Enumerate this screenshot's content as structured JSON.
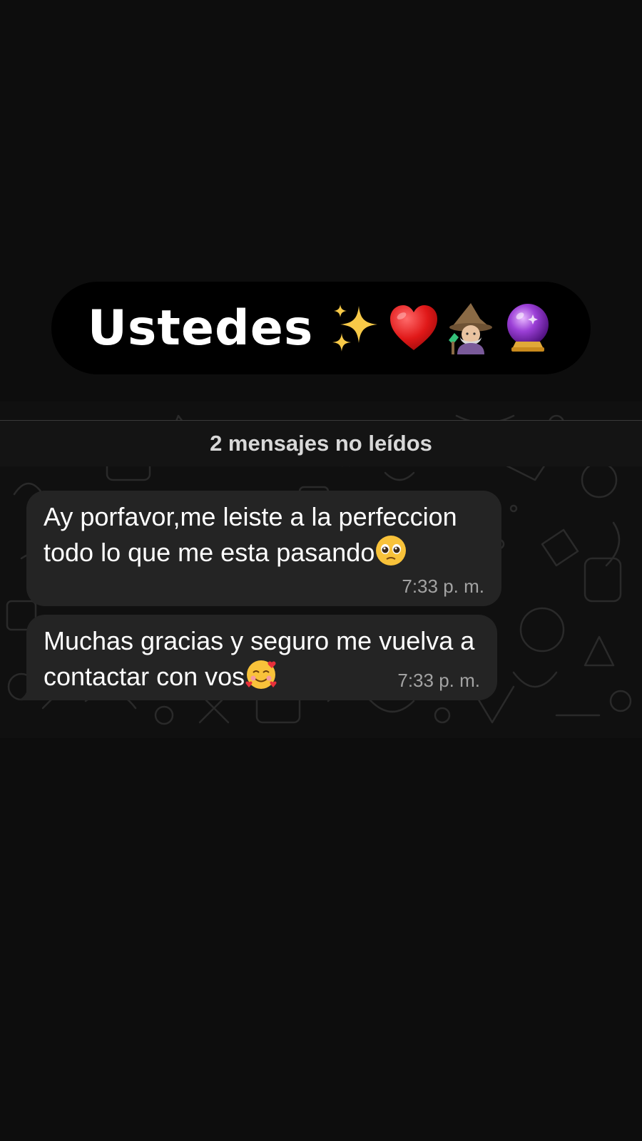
{
  "header": {
    "title": "Ustedes",
    "emojis": [
      "sparkles-icon",
      "red-heart-icon",
      "mage-icon",
      "crystal-ball-icon"
    ]
  },
  "chat": {
    "unread_banner": "2 mensajes no leídos",
    "messages": [
      {
        "text": "Ay porfavor,me leiste a la perfeccion todo lo que me esta pasando",
        "emoji": "pleading-face-icon",
        "time": "7:33 p. m."
      },
      {
        "text": "Muchas gracias y seguro me vuelva a contactar con vos",
        "emoji": "smiling-face-with-hearts-icon",
        "time": "7:33 p. m."
      }
    ]
  },
  "colors": {
    "background": "#0d0d0d",
    "title_pill": "#000000",
    "bubble": "#242424",
    "time_text": "#a3a3a3"
  }
}
